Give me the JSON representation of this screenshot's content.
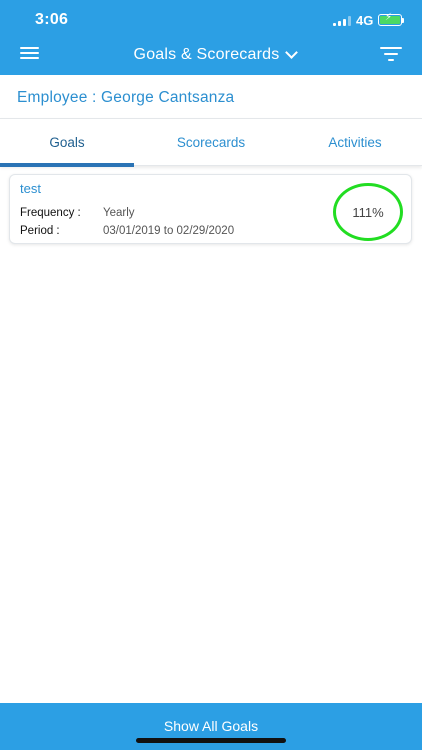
{
  "status_bar": {
    "time": "3:06",
    "network": "4G"
  },
  "header": {
    "title": "Goals & Scorecards"
  },
  "employee_line": "Employee : George Cantsanza",
  "tabs": [
    {
      "label": "Goals",
      "active": true
    },
    {
      "label": "Scorecards",
      "active": false
    },
    {
      "label": "Activities",
      "active": false
    }
  ],
  "goals": [
    {
      "name": "test",
      "frequency_label": "Frequency :",
      "frequency": "Yearly",
      "period_label": "Period :",
      "period": "03/01/2019 to 02/29/2020",
      "achievement": "111%",
      "achievement_color": "#22dd22"
    }
  ],
  "footer": {
    "button_label": "Show All Goals"
  },
  "colors": {
    "brand": "#2c9fe4",
    "link": "#2c8fd0",
    "tab_indicator": "#2a73b5"
  }
}
